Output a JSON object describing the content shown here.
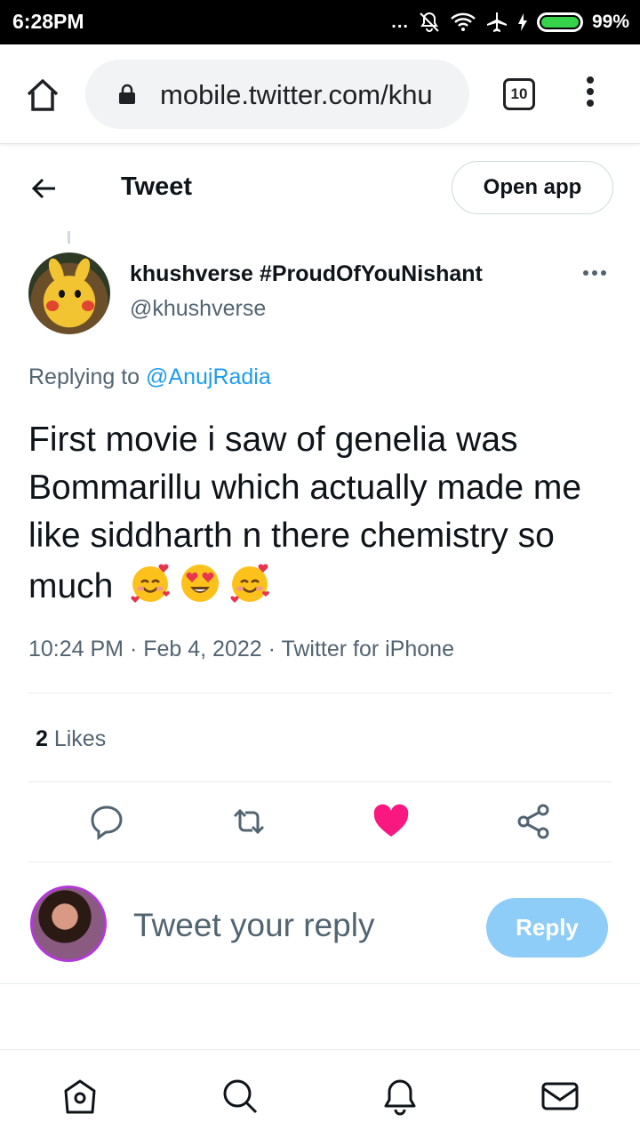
{
  "status_bar": {
    "time": "6:28PM",
    "more_dots": "...",
    "battery_percent": "99%",
    "battery_level": 0.99,
    "icons": [
      "mute-icon",
      "wifi-icon",
      "airplane-icon",
      "charging-icon",
      "battery-icon"
    ]
  },
  "browser": {
    "url": "mobile.twitter.com/khu",
    "tab_count": "10",
    "icons": [
      "home-icon",
      "lock-icon",
      "menu-icon"
    ]
  },
  "header": {
    "title": "Tweet",
    "open_app_label": "Open app"
  },
  "tweet": {
    "display_name": "khushverse #ProudOfYouNishant",
    "handle": "@khushverse",
    "replying_prefix": "Replying to ",
    "replying_to": "@AnujRadia",
    "text": "First movie i saw of genelia was Bommarillu which actually made me like siddharth n there chemistry so much",
    "emojis": [
      "smiling-face-with-hearts",
      "heart-eyes",
      "smiling-face-with-hearts"
    ],
    "time": "10:24 PM",
    "date": "Feb 4, 2022",
    "source": "Twitter for iPhone",
    "separator": " · ",
    "like_count": "2",
    "likes_label": " Likes"
  },
  "reply_box": {
    "placeholder": "Tweet your reply",
    "reply_label": "Reply"
  },
  "colors": {
    "accent": "#1d9bf0",
    "like": "#f91880",
    "reply_disabled": "#8ecdf8",
    "secondary_text": "#536471"
  }
}
